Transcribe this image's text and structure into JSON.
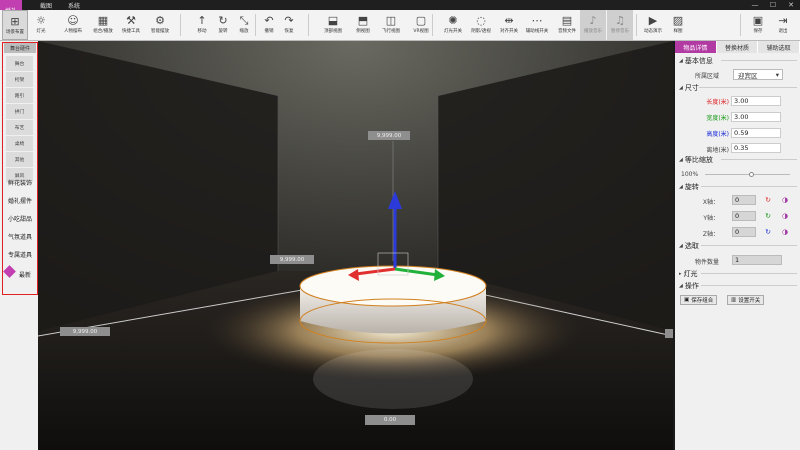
{
  "menubar": {
    "logo": "婚礼",
    "items": [
      "截图",
      "系统"
    ],
    "minimize": "—",
    "maximize": "☐",
    "close": "✕"
  },
  "toolbar": {
    "buttons": [
      {
        "label": "场景布置",
        "icon": "⊞"
      },
      {
        "label": "灯光",
        "icon": "☼"
      },
      {
        "label": "人物摆布",
        "icon": "☺"
      },
      {
        "label": "组合/播放",
        "icon": "▦"
      },
      {
        "label": "快捷工具",
        "icon": "⚒"
      },
      {
        "label": "智能摆放",
        "icon": "⚙"
      },
      {
        "label": "移动",
        "icon": "↑"
      },
      {
        "label": "旋转",
        "icon": "↻"
      },
      {
        "label": "缩放",
        "icon": "⤡"
      },
      {
        "label": "撤销",
        "icon": "↶"
      },
      {
        "label": "恢复",
        "icon": "↷"
      },
      {
        "label": "顶部视图",
        "icon": "⬓"
      },
      {
        "label": "侧视图",
        "icon": "⬒"
      },
      {
        "label": "飞行视图",
        "icon": "◫"
      },
      {
        "label": "VR视图",
        "icon": "▢"
      },
      {
        "label": "灯光开关",
        "icon": "✺"
      },
      {
        "label": "阴影/透视",
        "icon": "◌"
      },
      {
        "label": "对齐开关",
        "icon": "⇹"
      },
      {
        "label": "辅助线开关",
        "icon": "⋯"
      },
      {
        "label": "音频文件",
        "icon": "▤"
      },
      {
        "label": "播放音乐",
        "icon": "♪"
      },
      {
        "label": "暂停音乐",
        "icon": "♫"
      },
      {
        "label": "动态演示",
        "icon": "▶"
      },
      {
        "label": "样图",
        "icon": "▨"
      },
      {
        "label": "保存",
        "icon": "▣"
      },
      {
        "label": "退出",
        "icon": "⇥"
      }
    ]
  },
  "sidebar": {
    "header": "舞台硬件",
    "sub_items": [
      "舞台",
      "桁架",
      "路引",
      "拱门",
      "布艺",
      "桌椅",
      "其他",
      "屏风"
    ],
    "categories": [
      "鲜花装饰",
      "婚礼摆件",
      "小吃甜品",
      "气氛道具",
      "专属道具",
      "最新"
    ]
  },
  "viewport": {
    "labels": [
      "9,999.00",
      "9,999.00",
      "9,999.00",
      "0.00"
    ]
  },
  "panel": {
    "tabs": [
      "物品详情",
      "替换材质",
      "辅助选取"
    ],
    "basic": {
      "title": "基本信息",
      "area_label": "所属区域",
      "area_value": "迎宾区"
    },
    "size": {
      "title": "尺寸",
      "length_label": "长度(米)",
      "length": "3.00",
      "width_label": "宽度(米)",
      "width": "3.00",
      "height_label": "高度(米)",
      "height": "0.59",
      "ground_label": "离地(米)",
      "ground": "0.35"
    },
    "scale": {
      "title": "等比缩放",
      "value": "100%",
      "level": 0.55
    },
    "rotate": {
      "title": "旋转",
      "x_label": "X轴：",
      "x": "0",
      "y_label": "Y轴：",
      "y": "0",
      "z_label": "Z轴：",
      "z": "0"
    },
    "select": {
      "title": "选取",
      "count_label": "物件数量",
      "count": "1"
    },
    "light": {
      "title": "灯光"
    },
    "ops": {
      "title": "操作",
      "save_label": "保存组合",
      "toggle_label": "设置开关"
    }
  },
  "colors": {
    "accent": "#b23aa3",
    "red_outline": "#e02020",
    "length_color": "#d22",
    "width_color": "#1a9a1a",
    "height_color": "#1a2dd8"
  }
}
